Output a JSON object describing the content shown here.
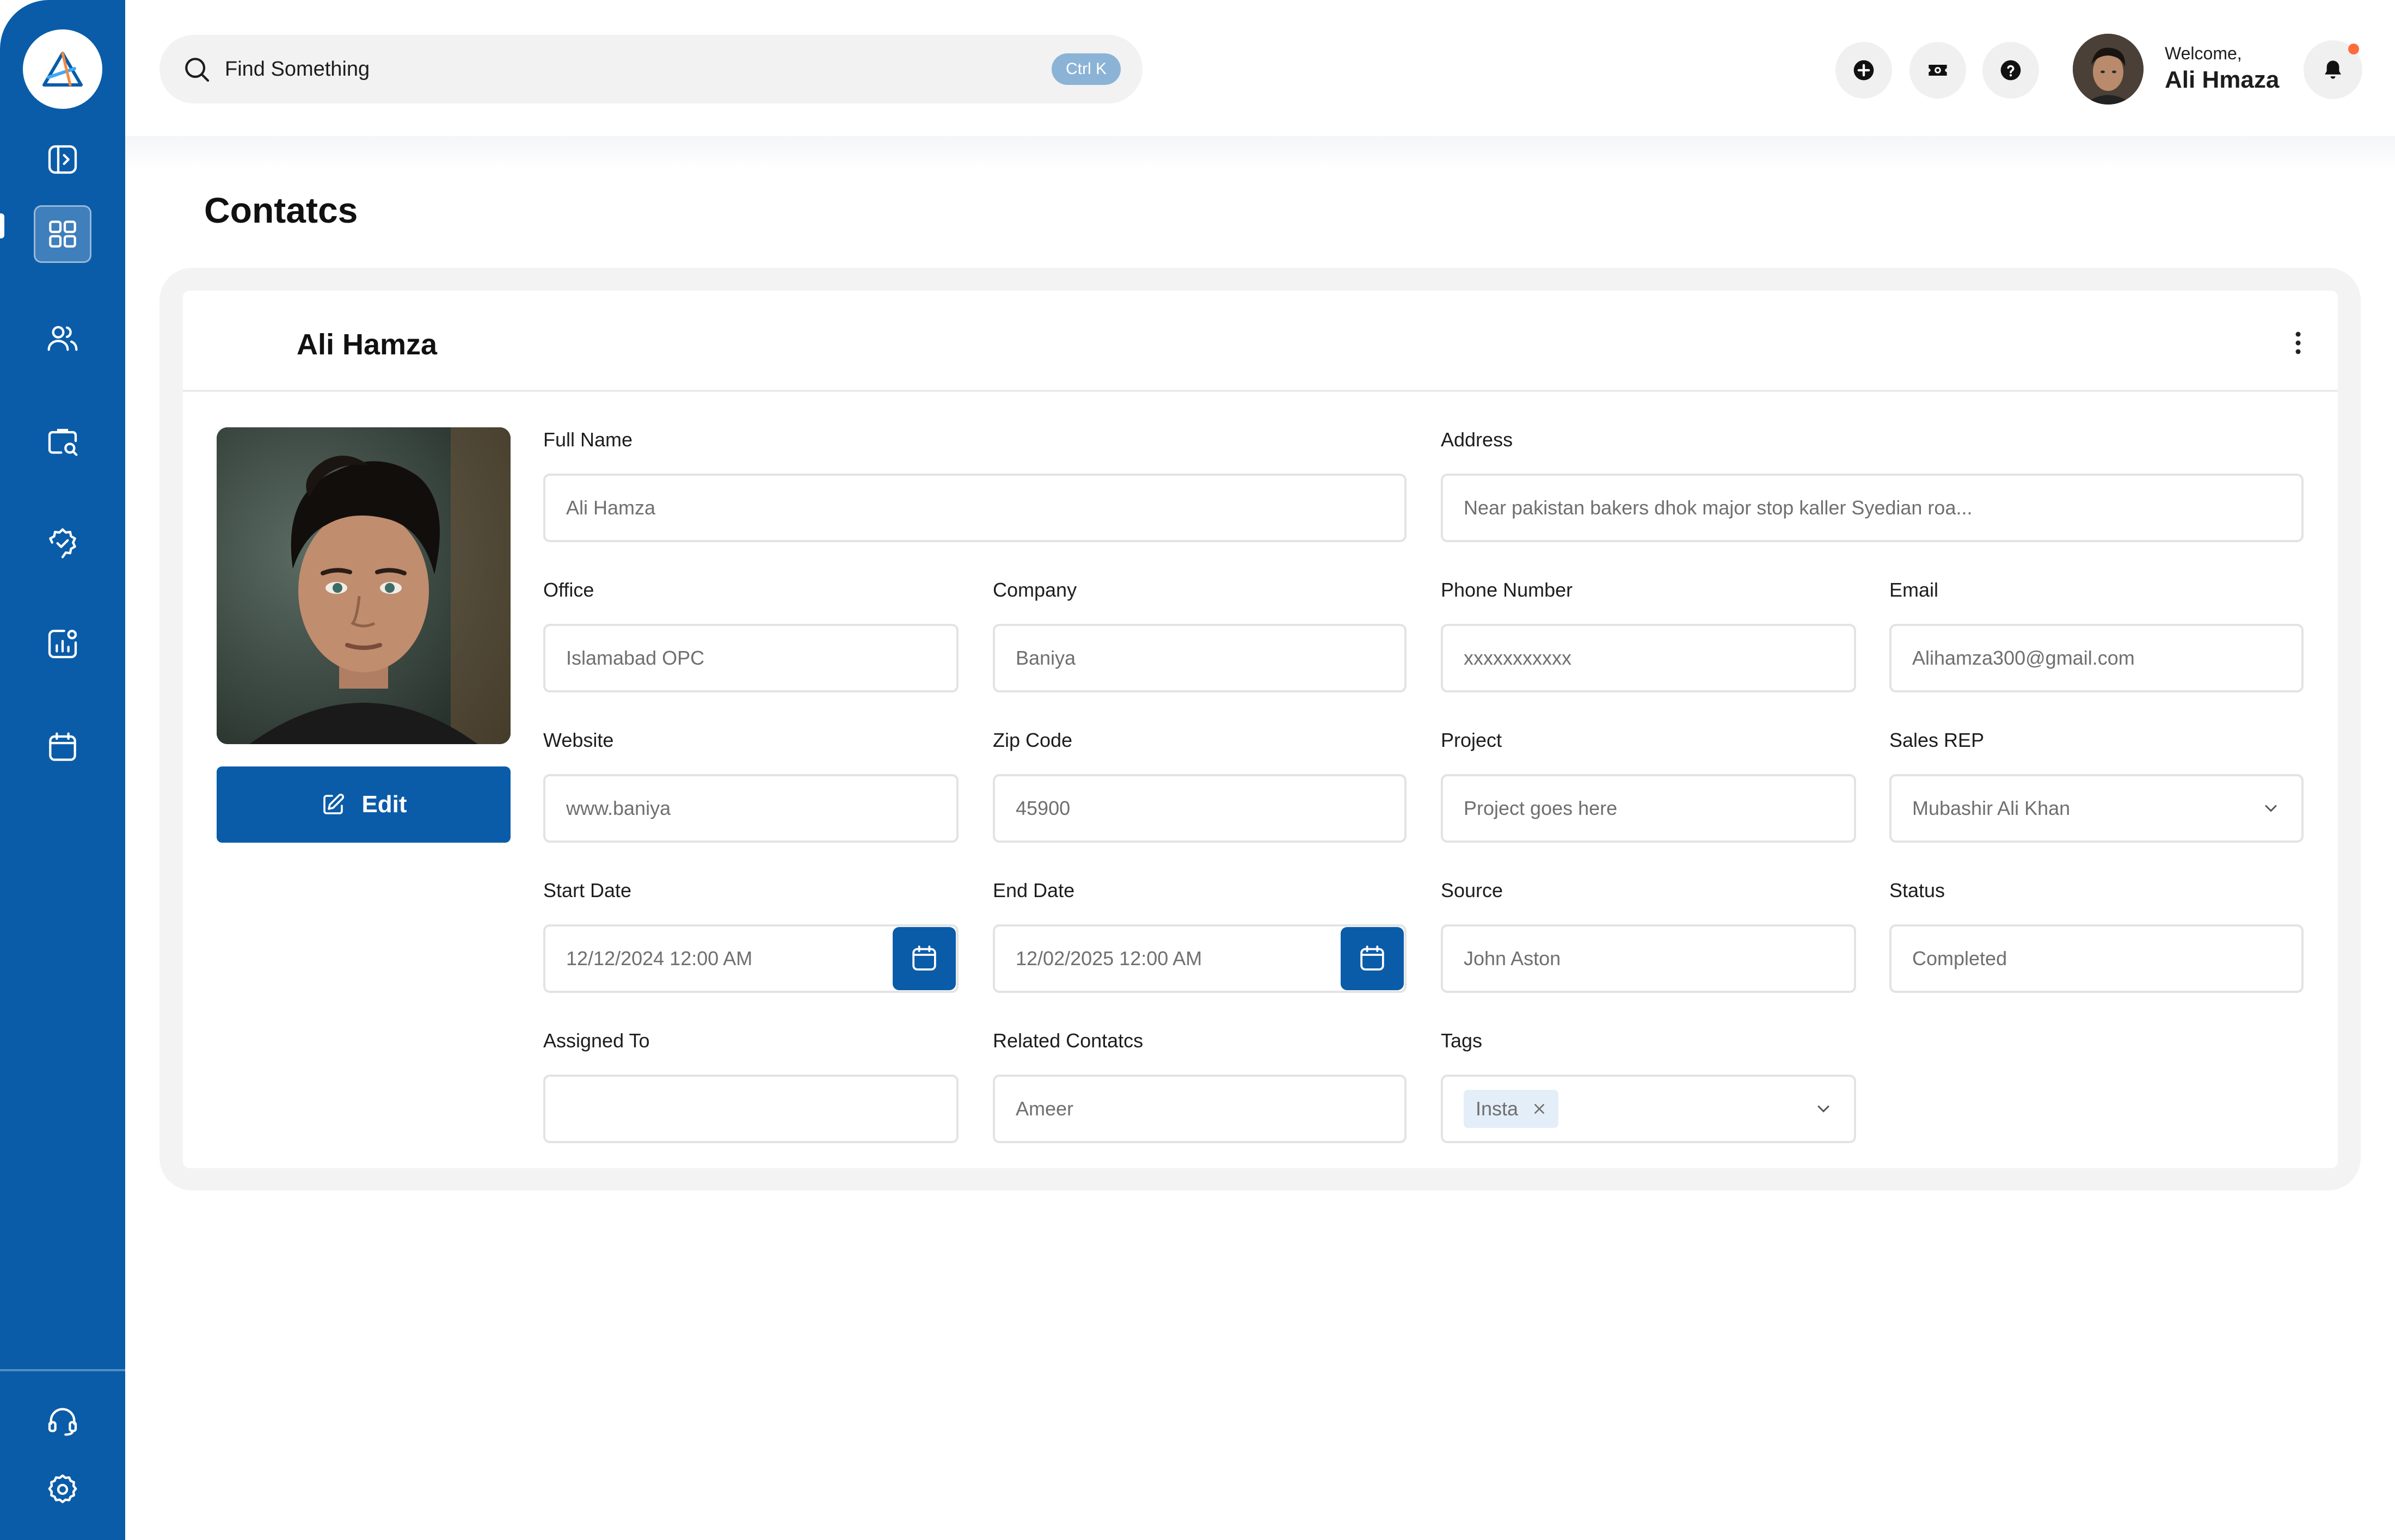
{
  "search": {
    "placeholder": "Find Something",
    "shortcut": "Ctrl K"
  },
  "user": {
    "greeting": "Welcome,",
    "name": "Ali Hmaza"
  },
  "sidebar": {
    "items": [
      {
        "icon": "panel-toggle-icon"
      },
      {
        "icon": "dashboard-icon",
        "active": true
      },
      {
        "icon": "users-icon"
      },
      {
        "icon": "briefcase-search-icon"
      },
      {
        "icon": "badge-icon"
      },
      {
        "icon": "analytics-icon"
      },
      {
        "icon": "calendar-icon"
      }
    ],
    "bottom": [
      {
        "icon": "headset-icon"
      },
      {
        "icon": "settings-icon"
      }
    ]
  },
  "page": {
    "title": "Contatcs"
  },
  "contact": {
    "header_name": "Ali Hamza",
    "edit_label": "Edit",
    "fields": {
      "full_name": {
        "label": "Full Name",
        "value": "Ali Hamza"
      },
      "address": {
        "label": "Address",
        "value": "Near pakistan  bakers dhok major stop kaller Syedian roa..."
      },
      "office": {
        "label": "Office",
        "value": "Islamabad OPC"
      },
      "company": {
        "label": "Company",
        "value": "Baniya"
      },
      "phone": {
        "label": "Phone Number",
        "value": "xxxxxxxxxxx"
      },
      "email": {
        "label": "Email",
        "value": "Alihamza300@gmail.com"
      },
      "website": {
        "label": "Website",
        "value": "www.baniya"
      },
      "zip": {
        "label": "Zip Code",
        "value": "45900"
      },
      "project": {
        "label": "Project",
        "value": "Project goes here"
      },
      "sales_rep": {
        "label": "Sales REP",
        "value": "Mubashir Ali Khan"
      },
      "start_date": {
        "label": "Start Date",
        "value": "12/12/2024 12:00 AM"
      },
      "end_date": {
        "label": "End Date",
        "value": "12/02/2025 12:00 AM"
      },
      "source": {
        "label": "Source",
        "value": "John Aston"
      },
      "status": {
        "label": "Status",
        "value": "Completed"
      },
      "assigned_to": {
        "label": "Assigned To",
        "value": ""
      },
      "related_contacts": {
        "label": "Related Contatcs",
        "value": "Ameer"
      },
      "tags": {
        "label": "Tags",
        "values": [
          "Insta"
        ]
      }
    }
  },
  "colors": {
    "brand": "#0A5CA8",
    "notification_dot": "#FF6B3D",
    "shortcut_badge": "#8BB3D6"
  }
}
